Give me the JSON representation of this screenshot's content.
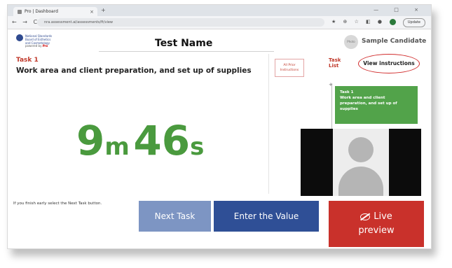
{
  "browser": {
    "tab_title": "Pro | Dashboard",
    "tab_close": "×",
    "new_tab": "+",
    "window_controls": "— □ ×",
    "nav_glyphs": "← → C",
    "url": "nra.assessment.ai/assessments/ft/view",
    "ext_glyphs": "★ ⊕ ☆ ◧ ●",
    "update_label": "Update"
  },
  "header": {
    "logo_text": "National Standards Board of Esthetics and Cosmetology",
    "logo_powered": "powered by",
    "logo_brand": "Pro",
    "test_name": "Test Name",
    "avatar_text": "Photo",
    "candidate_name": "Sample Candidate"
  },
  "task": {
    "label": "Task 1",
    "title": "Work area and client preparation, and set up of supplies",
    "all_instructions": "All Prior Instructions",
    "task_list_label": "Task List",
    "view_instructions": "View instructions",
    "card_task": "Task 1",
    "card_title": "Work area and client preparation, and set up of supplies",
    "timeline_marker": "+"
  },
  "timer": {
    "minutes": "9",
    "minutes_unit": "m",
    "seconds": "46",
    "seconds_unit": "s"
  },
  "footer": {
    "hint": "If you finish early select the Next Task button.",
    "next_task": "Next Task",
    "enter_value": "Enter the Value",
    "live_preview_line1": "Live",
    "live_preview_line2": "preview"
  },
  "colors": {
    "timer": "#4a9a3e",
    "task_card": "#52a34a",
    "next_btn": "#7d95c3",
    "enter_btn": "#2f4f96",
    "live_btn": "#c9312b",
    "accent_red": "#c0392b"
  },
  "icons": {
    "live_preview": "eye-slash-icon",
    "profile": "profile-icon",
    "favicon": "favicon-icon"
  }
}
